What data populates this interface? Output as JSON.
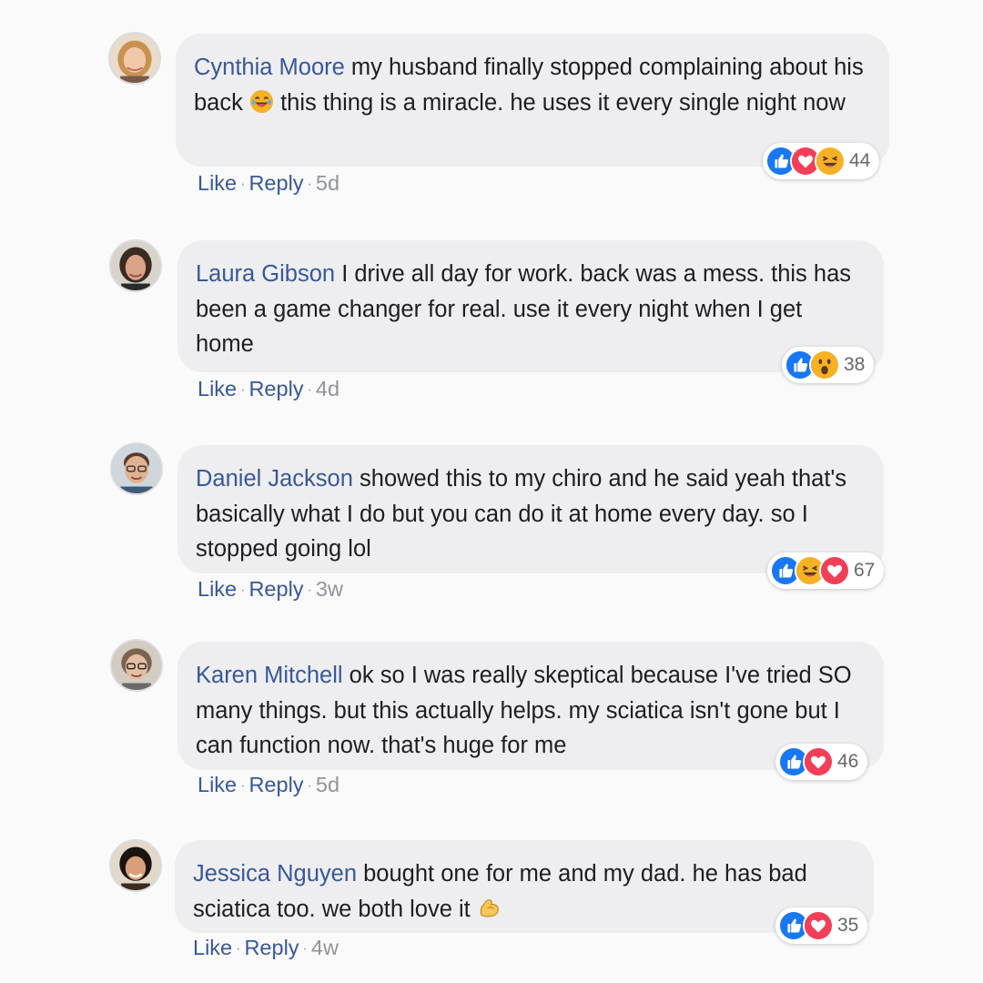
{
  "comments": [
    {
      "author": "Cynthia Moore",
      "text_before": "my husband finally stopped complaining about his back",
      "inline_emoji": "laughing-tears-emoji",
      "text_after": "this thing is a miracle. he uses it every single night now",
      "like_label": "Like",
      "reply_label": "Reply",
      "separator": "·",
      "time": "5d",
      "reactions": [
        "like",
        "love",
        "haha"
      ],
      "reaction_count": "44"
    },
    {
      "author": "Laura Gibson",
      "text_before": "I drive all day for work. back was a mess. this has been a game changer for real. use it every night when I get home",
      "like_label": "Like",
      "reply_label": "Reply",
      "separator": "·",
      "time": "4d",
      "reactions": [
        "like",
        "wow"
      ],
      "reaction_count": "38"
    },
    {
      "author": "Daniel Jackson",
      "text_before": "showed this to my chiro and he said yeah that's basically what I do but you can do it at home every day. so I stopped going lol",
      "like_label": "Like",
      "reply_label": "Reply",
      "separator": "·",
      "time": "3w",
      "reactions": [
        "like",
        "haha",
        "love"
      ],
      "reaction_count": "67"
    },
    {
      "author": "Karen Mitchell",
      "text_before": "ok so I was really skeptical because I've tried SO many things. but this actually helps. my sciatica isn't gone but I can function now. that's huge for me",
      "like_label": "Like",
      "reply_label": "Reply",
      "separator": "·",
      "time": "5d",
      "reactions": [
        "like",
        "love"
      ],
      "reaction_count": "46"
    },
    {
      "author": "Jessica Nguyen",
      "text_before": "bought one for me and my dad. he has bad sciatica too. we both love it",
      "inline_emoji": "flexed-biceps-emoji",
      "like_label": "Like",
      "reply_label": "Reply",
      "separator": "·",
      "time": "4w",
      "reactions": [
        "like",
        "love"
      ],
      "reaction_count": "35"
    }
  ],
  "colors": {
    "author_link": "#385898",
    "like_blue": "#1877f2",
    "love_red": "#f33e58",
    "haha_yellow": "#f7b125",
    "bubble_bg": "#eeeef0"
  }
}
